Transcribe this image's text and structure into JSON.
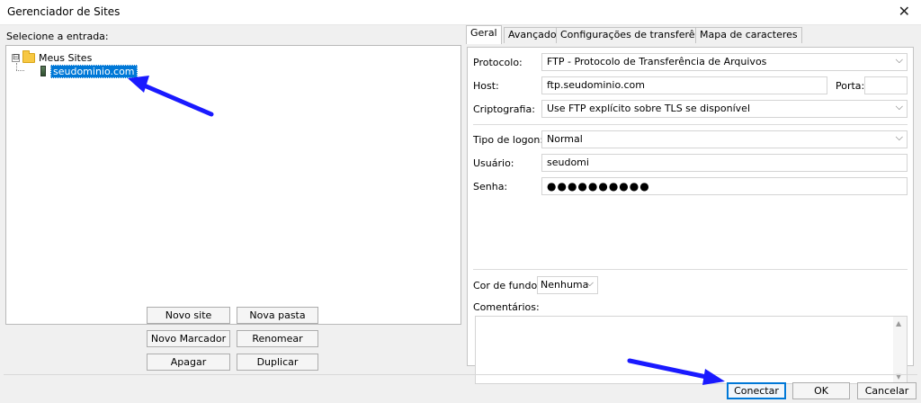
{
  "window": {
    "title": "Gerenciador de Sites"
  },
  "left": {
    "label": "Selecione a entrada:",
    "tree": {
      "root": {
        "label": "Meus Sites",
        "expander": "⊟"
      },
      "child": {
        "label": "seudominio.com"
      }
    },
    "buttons": {
      "new_site": "Novo site",
      "new_folder": "Nova pasta",
      "new_bookmark": "Novo Marcador",
      "rename": "Renomear",
      "delete": "Apagar",
      "duplicate": "Duplicar"
    }
  },
  "tabs": [
    {
      "label": "Geral",
      "active": true
    },
    {
      "label": "Avançado",
      "active": false
    },
    {
      "label": "Configurações de transferência",
      "active": false
    },
    {
      "label": "Mapa de caracteres",
      "active": false
    }
  ],
  "general": {
    "protocol": {
      "label": "Protocolo:",
      "value": "FTP - Protocolo de Transferência de Arquivos"
    },
    "host": {
      "label": "Host:",
      "value": "ftp.seudominio.com"
    },
    "port": {
      "label": "Porta:",
      "value": ""
    },
    "encryption": {
      "label": "Criptografia:",
      "value": "Use FTP explícito sobre TLS se disponível"
    },
    "logon_type": {
      "label": "Tipo de logon:",
      "value": "Normal"
    },
    "user": {
      "label": "Usuário:",
      "value": "seudomi"
    },
    "password": {
      "label": "Senha:",
      "value": "●●●●●●●●●●"
    },
    "background_color": {
      "label": "Cor de fundo:",
      "value": "Nenhuma"
    },
    "comments": {
      "label": "Comentários:",
      "value": ""
    }
  },
  "footer": {
    "connect": "Conectar",
    "ok": "OK",
    "cancel": "Cancelar"
  },
  "icons": {
    "close": "close-icon",
    "folder": "folder-icon",
    "server": "server-icon",
    "dropdown": "chevron-down-icon",
    "annotation": "arrow-annotation-icon"
  },
  "colors": {
    "selection": "#0078d7",
    "annotation_arrow": "#1a1aff",
    "dialog_bg": "#f0f0f0",
    "folder": "#f7c843"
  }
}
